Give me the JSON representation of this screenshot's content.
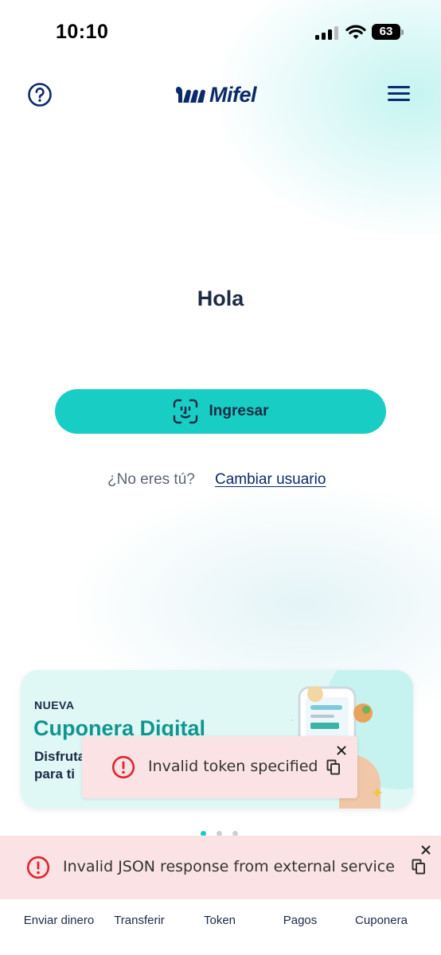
{
  "status_bar": {
    "time": "10:10",
    "battery": "63"
  },
  "header": {
    "help_icon": "question-circle-icon",
    "logo_text": "Mifel",
    "menu_icon": "hamburger-menu-icon"
  },
  "main": {
    "greeting": "Hola",
    "login_button_label": "Ingresar",
    "login_button_icon": "face-id-icon",
    "not_you_text": "¿No eres tú?",
    "change_user_link": "Cambiar usuario"
  },
  "promo": {
    "badge": "NUEVA",
    "title": "Cuponera Digital",
    "description": "Disfruta para ti",
    "carousel_pages": 3,
    "carousel_active": 1
  },
  "toasts": {
    "token_error": "Invalid token specified",
    "json_error": "Invalid JSON response from external service"
  },
  "bottom_nav": {
    "items": [
      {
        "label": "Enviar dinero"
      },
      {
        "label": "Transferir"
      },
      {
        "label": "Token"
      },
      {
        "label": "Pagos"
      },
      {
        "label": "Cuponera"
      }
    ]
  },
  "colors": {
    "brand_navy": "#0c2a6b",
    "primary_teal": "#18cdc4",
    "promo_title": "#12958f",
    "error_red": "#e0242e",
    "toast_bg": "#fbe3e5"
  }
}
